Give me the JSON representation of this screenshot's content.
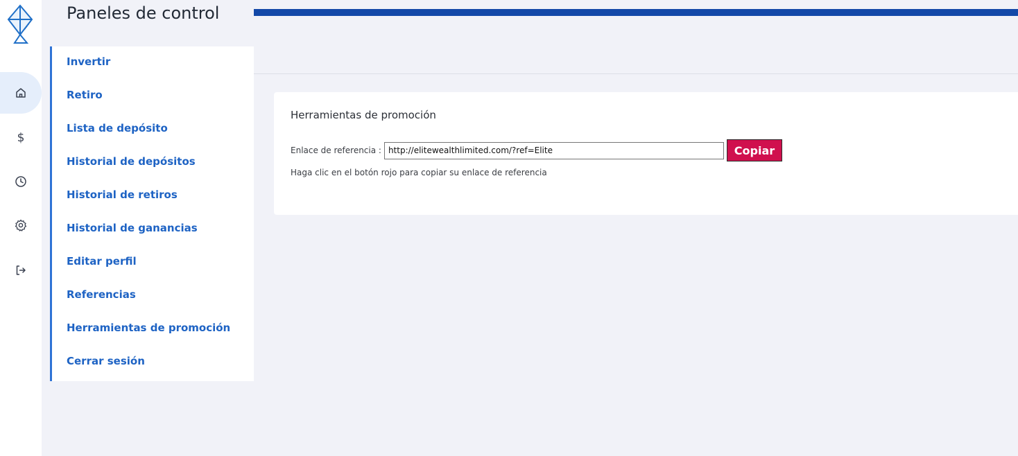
{
  "sidebar": {
    "title": "Paneles de control",
    "items": [
      {
        "label": "Invertir"
      },
      {
        "label": "Retiro"
      },
      {
        "label": "Lista de depósito"
      },
      {
        "label": "Historial de depósitos"
      },
      {
        "label": "Historial de retiros"
      },
      {
        "label": "Historial de ganancias"
      },
      {
        "label": "Editar perfil"
      },
      {
        "label": "Referencias"
      },
      {
        "label": "Herramientas de promoción"
      },
      {
        "label": "Cerrar sesión"
      }
    ]
  },
  "icon_rail": {
    "logo": "kite-logo-icon",
    "items": [
      {
        "icon": "home-icon",
        "active": true
      },
      {
        "icon": "dollar-icon",
        "glyph": "$"
      },
      {
        "icon": "clock-icon"
      },
      {
        "icon": "gear-icon"
      },
      {
        "icon": "logout-icon"
      }
    ]
  },
  "promotion": {
    "title": "Herramientas de promoción",
    "referral_label": "Enlace de referencia :",
    "referral_value": "http://elitewealthlimited.com/?ref=Elite",
    "copy_button": "Copiar",
    "help_text": "Haga clic en el botón rojo para copiar su enlace de referencia"
  },
  "colors": {
    "accent": "#1e63c4",
    "topbar": "#1348a8",
    "copy_button": "#d0104e",
    "background": "#f1f2f8"
  }
}
